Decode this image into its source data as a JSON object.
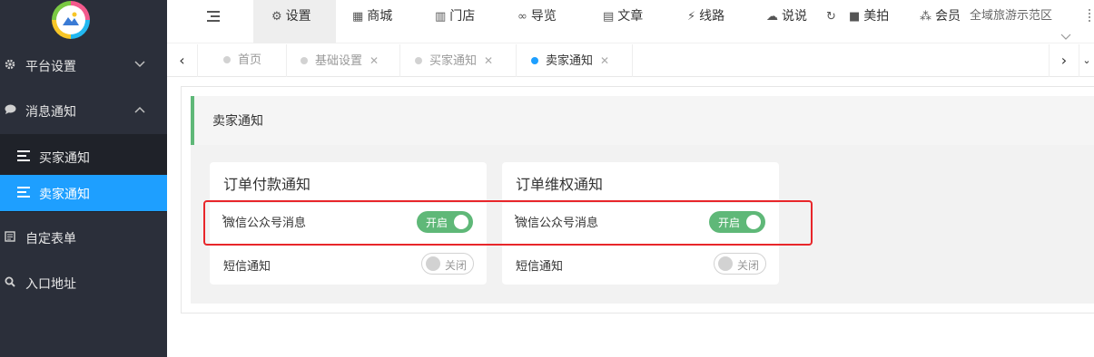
{
  "colors": {
    "sidebar_bg": "#2b2f3a",
    "accent": "#1e9fff",
    "switch_on": "#5fb878",
    "highlight": "#e8262a"
  },
  "sidebar": {
    "items": [
      {
        "label": "平台设置",
        "icon": "gear-icon",
        "chevron": "chevron-down-icon"
      },
      {
        "label": "消息通知",
        "icon": "chat-bubble-icon",
        "chevron": "chevron-up-icon"
      },
      {
        "label": "自定表单",
        "icon": "form-icon"
      },
      {
        "label": "入口地址",
        "icon": "search-icon"
      }
    ],
    "sub_items": [
      {
        "label": "买家通知",
        "active": false
      },
      {
        "label": "卖家通知",
        "active": true
      }
    ]
  },
  "topbar": {
    "items": [
      {
        "label": "设置",
        "icon": "gears-icon",
        "active": true
      },
      {
        "label": "商城",
        "icon": "shop-icon"
      },
      {
        "label": "门店",
        "icon": "bank-icon"
      },
      {
        "label": "导览",
        "icon": "binoculars-icon"
      },
      {
        "label": "文章",
        "icon": "newspaper-icon"
      },
      {
        "label": "线路",
        "icon": "route-icon"
      },
      {
        "label": "说说",
        "icon": "wechat-icon"
      },
      {
        "label": "",
        "icon": "refresh-icon"
      },
      {
        "label": "美拍",
        "icon": "video-icon"
      },
      {
        "label": "会员",
        "icon": "members-icon"
      }
    ],
    "site_name": "全域旅游示范区"
  },
  "tabs": [
    {
      "label": "首页",
      "closable": false,
      "active": false
    },
    {
      "label": "基础设置",
      "closable": true,
      "active": false
    },
    {
      "label": "买家通知",
      "closable": true,
      "active": false
    },
    {
      "label": "卖家通知",
      "closable": true,
      "active": true
    }
  ],
  "page": {
    "title": "卖家通知"
  },
  "cards": [
    {
      "title": "订单付款通知",
      "rows": [
        {
          "label": "微信公众号消息",
          "state": "开启",
          "on": true
        },
        {
          "label": "短信通知",
          "state": "关闭",
          "on": false
        }
      ]
    },
    {
      "title": "订单维权通知",
      "rows": [
        {
          "label": "微信公众号消息",
          "state": "开启",
          "on": true
        },
        {
          "label": "短信通知",
          "state": "关闭",
          "on": false
        }
      ]
    }
  ]
}
